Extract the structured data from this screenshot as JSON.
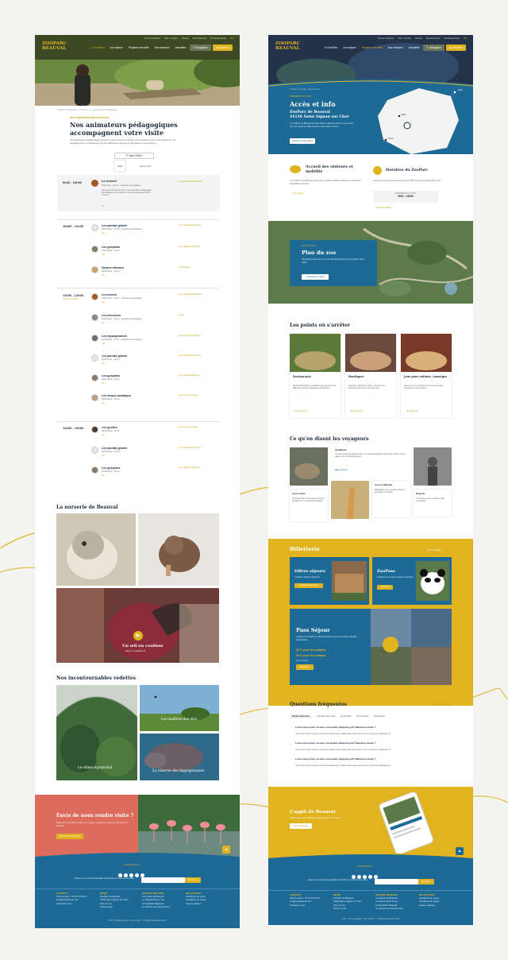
{
  "left_page": {
    "utility_links": [
      "Nous contacter",
      "Mon compte",
      "Presse",
      "Recrutement",
      "Professionnels",
      "FR"
    ],
    "nav": [
      "Le ZooParc",
      "Les séjours",
      "Préparer ma visite",
      "Nos missions",
      "Actualités"
    ],
    "nav_active": "Le ZooParc",
    "btn_navigation": "Navigation",
    "btn_reserver": "Réserver",
    "breadcrumb": "ZooParc de Beauval › Le ZooParc › Les animateurs pédagogiques",
    "kicker": "NOS ANIMATEURS PÉDAGOGIQUES",
    "title": "Nos animateurs pédagogiques accompagnent votre visite",
    "intro": "Nos animateurs pédagogiques donnent rendez-vous aux visiteurs pour quelques mots sur les soigneurs. Ils partagent leurs connaissances sur les différentes espèces et répondent à vos questions.",
    "date": "27 août 2018",
    "toggle_left": "matin",
    "toggle_right": "après-midi",
    "slots": [
      {
        "time": "9h30 - 10h00",
        "events": [
          {
            "name": "La nurserie",
            "meta": "9h30 durée · 15 min · animation accompagnée",
            "desc": "Découvrez le bébé de l'heure. Une animatrice pédagogique accompagnée d'un soigneur vous présente les petits de la nurserie.",
            "link": "Lire",
            "loc": "La nurserie de Beauval"
          }
        ]
      },
      {
        "time": "10h00 - 11h00",
        "events": [
          {
            "name": "Les pandas géants",
            "meta": "10h00 durée · 15 min · animation accompagnée",
            "link": "Lire",
            "loc": "Les hauteurs de Chine"
          },
          {
            "name": "Les guépards",
            "meta": "10h30 durée · 15 min",
            "link": "Lire",
            "loc": "Les plaines africaines"
          },
          {
            "name": "Savane africaine",
            "meta": "10h45 durée · 15 min",
            "link": "Lire",
            "loc": "La Savane"
          }
        ]
      },
      {
        "time": "11h00 - 12h00",
        "note": "En ce moment",
        "events": [
          {
            "name": "La nurserie",
            "meta": "11h00 durée · 15 min · animation accompagnée",
            "link": "Lire",
            "loc": "La nurserie de Beauval"
          },
          {
            "name": "Les lémuriens",
            "meta": "11h10 durée · 15 min · animation accompagnée",
            "link": "Lire",
            "loc": "Lac"
          },
          {
            "name": "Les hippopotames",
            "meta": "11h20 durée · 15 min · animation accompagnée",
            "link": "Lire",
            "loc": "La réserve des hippos"
          },
          {
            "name": "Les pandas géants",
            "meta": "11h30 durée · 15 min",
            "link": "Lire",
            "loc": "Les hauteurs de Chine"
          },
          {
            "name": "Les guépards",
            "meta": "11h40 durée · 15 min",
            "link": "Lire",
            "loc": "Les plaines africaines"
          },
          {
            "name": "Les singes asiatiques",
            "meta": "11h50 durée · 15 min",
            "link": "Lire",
            "loc": "La Terre des singes"
          }
        ]
      },
      {
        "time": "12h00 - 13h00",
        "events": [
          {
            "name": "Les gorilles",
            "meta": "12h00 durée · 15 min",
            "link": "Lire",
            "loc": "La Terre des singes"
          },
          {
            "name": "Les pandas géants",
            "meta": "12h15 durée · 15 min",
            "link": "Lire",
            "loc": "Les hauteurs de Chine"
          },
          {
            "name": "Les guépards",
            "meta": "12h30 durée · 15 min",
            "link": "Lire",
            "loc": "Les plaines africaines"
          }
        ]
      }
    ],
    "nursery_title": "La nurserie de Beauval",
    "video_title": "Un œil en coulisse",
    "video_sub": "Saison 3 | Épisode 01",
    "highlights_title": "Nos incontournables vedettes",
    "highlights": [
      "Le dôme équatorial",
      "Les maîtres des airs",
      "La réserve des hippopotames"
    ],
    "cta_title": "Envie de nous rendre visite ?",
    "cta_text": "Découvrez nos offres et réservez en ligne vos billets et séjours au ZooParc de Beauval.",
    "cta_btn": "Découvrir les offres",
    "footer_follow": "SUIVEZ-NOUS",
    "footer_newsletter": "Restez au courant de l'actualité du ZooParc et recevez nos offres.",
    "footer_subscribe": "S'inscrire",
    "footer_cols": [
      {
        "title": "CONTACT",
        "items": [
          "Service client : 02 54 75 50 00",
          "info@zoobeauval.com",
          "Contactez-nous"
        ]
      },
      {
        "title": "INFOS",
        "items": [
          "ZooParc de Beauval",
          "41110 Saint-Aignan sur Cher",
          "Plan du zoo",
          "Accès et info"
        ]
      },
      {
        "title": "GROUPE BEAUVAL",
        "items": [
          "Les hôtels de Beauval",
          "Le Grand Récit du zoo",
          "La Fondation Beauval",
          "Le chemin des Découvertes"
        ]
      },
      {
        "title": "BILLETTERIE",
        "items": [
          "Conditions de vente",
          "Conditions de séjour",
          "Cartes cadeaux"
        ]
      }
    ],
    "footer_legal": [
      "CGU",
      "Mentions légales",
      "Plan du site",
      "© ZooParc de Beauval 2018"
    ]
  },
  "right_page": {
    "utility_links": [
      "Nous contacter",
      "Mon compte",
      "Presse",
      "Recrutement",
      "Professionnels",
      "FR"
    ],
    "nav": [
      "Le ZooParc",
      "Les séjours",
      "Préparer ma visite",
      "Nos missions",
      "Actualités"
    ],
    "nav_active": "Préparer ma visite",
    "btn_navigation": "Navigation",
    "btn_reserver": "Réserver",
    "breadcrumb": "Préparer ma visite › Accès et info",
    "kicker": "PRÉPARER MA VISITE",
    "title": "Accès et info",
    "park_name": "ZooParc de Beauval",
    "park_address": "41110 Saint Aignan sur Cher",
    "park_text": "Le ZooParc de Beauval est situé dans le département du Loir-et-Cher (41), au sud de la vallée du Cher, entre Paris et Tours.",
    "park_btn": "Itinéraire Google Maps",
    "map_cities": [
      "Paris",
      "Blois",
      "Tours"
    ],
    "accueil_title": "Accueil des visiteurs et mobilité",
    "accueil_text": "Le ZooParc accueille les personnes à mobilité réduite. Fauteuils et poussettes disponibles à l'entrée.",
    "accueil_link": "Lire la suite",
    "horaires_title": "Horaires du ZooParc",
    "horaires_text": "Ouvert tous les jours de l'année de 9h à 18h en hiver et jusqu'à 19h en été.",
    "horaires_box_title": "HORAIRES DU 27 AOÛT",
    "horaires_box_value": "9h00 - 19h00",
    "horaires_link": "Tous les horaires",
    "plan_kicker": "PLAN DU ZOO",
    "plan_title": "Plan du zoo",
    "plan_text": "Retrouvez le plan du zoo et ses 35 000 animaux pour préparer votre visite.",
    "plan_btn": "Télécharger le plan",
    "points_title": "Les points où s'arrêter",
    "points": [
      {
        "title": "Restaurants",
        "text": "Restauration rapide ou traditionnelle, découvrez les différents points de restauration du ZooParc.",
        "link": "En savoir plus"
      },
      {
        "title": "Boutiques",
        "text": "Souvenirs, peluches et livres, retrouvez nos boutiques tout au long de votre visite.",
        "link": "En savoir plus"
      },
      {
        "title": "Jeux pour enfants / manèges",
        "text": "Aires de jeux et manèges pour les plus petits à découvrir au cœur du parc.",
        "link": "En savoir plus"
      }
    ],
    "reviews_title": "Ce qu'en disent les voyageurs",
    "reviews": [
      {
        "name": "Guillaume",
        "text": "Un parc vraiment superbe avec une grande diversité d'animaux. Nous avons passé une très belle journée."
      },
      {
        "name": "Anne-Claire",
        "text": "Très beau parc, les animaux sont bien installés et il y a beaucoup d'espace."
      },
      {
        "name": "Aurore Sabatier",
        "text": "Magnifique parc, très bien entretenu, les enfants ont adoré."
      },
      {
        "name": "Evelyne",
        "text": "Une belle journée en famille, nous reviendrons."
      }
    ],
    "ticket_title": "Billetterie",
    "ticket_link": "Tous nos billets",
    "ticket_offres": "Offres séjours",
    "ticket_offres_sub": "À partir de 109€ par personne",
    "ticket_offres_btn": "Réserver votre séjour",
    "ticket_zoopass": "ZooPass",
    "ticket_zoopass_sub": "Profitez d'un an d'accès illimité au ZooParc",
    "ticket_zoopass_btn": "Découvrir",
    "pass_title": "Pass Séjour",
    "pass_text": "Accédez au ZooParc en illimité pendant 2 jours et profitez de tarifs préférentiels.",
    "pass_price1": "32 € pour les adultes",
    "pass_price2": "26 € pour les enfants",
    "pass_note": "De 3 à 10 ans",
    "pass_btn": "Réserver",
    "faq_title": "Questions fréquentes",
    "faq_link": "Toutes les questions",
    "faq_tabs": [
      "Santé et bien-être",
      "Pendant votre visite",
      "Le ZooParc",
      "Nos animaux",
      "Restaurants"
    ],
    "faq_q": "Lorem ipsum dolor sit amet, consectetur adipiscing elit? Maecenas iaculis ?",
    "faq_a": "Lorem ipsum dolor sit amet, consectetur adipiscing elit. Maecenas iaculis ultrices nunc, consectetur adipiscing elit.",
    "app_title": "L'appli de Beauval",
    "app_text": "Téléchargez notre application pour préparer votre visite.",
    "app_btn": "Voir l'application",
    "footer_follow": "SUIVEZ-NOUS",
    "footer_newsletter": "Restez au courant de l'actualité du ZooParc et recevez nos offres.",
    "footer_subscribe": "S'inscrire"
  },
  "colors": {
    "olive": "#3b4a24",
    "yellow": "#e0b31f",
    "blue": "#1e6a96",
    "coral": "#dc6d5d",
    "navy": "#1e2b3a"
  }
}
